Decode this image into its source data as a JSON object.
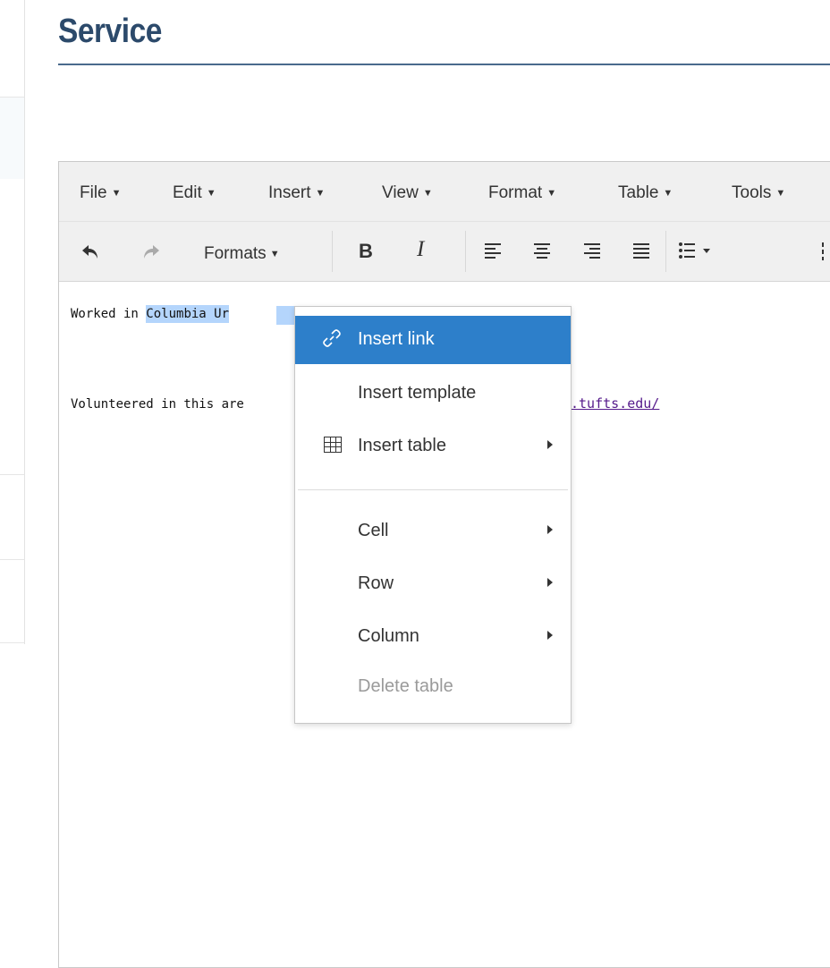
{
  "page": {
    "title": "Service"
  },
  "editor": {
    "menubar": [
      {
        "label": "File"
      },
      {
        "label": "Edit"
      },
      {
        "label": "Insert"
      },
      {
        "label": "View"
      },
      {
        "label": "Format"
      },
      {
        "label": "Table"
      },
      {
        "label": "Tools"
      }
    ],
    "toolbar": {
      "formats_label": "Formats",
      "bold_label": "B",
      "italic_label": "I",
      "undo_icon": "undo-icon",
      "redo_icon": "redo-icon"
    },
    "content": {
      "line1_prefix": "Worked in ",
      "line1_selected": "Columbia Ur",
      "line2_text": "Volunteered in this are",
      "line2_link_fragment": ".tufts.edu/"
    }
  },
  "context_menu": {
    "items": [
      {
        "label": "Insert link",
        "icon": "link-icon",
        "state": "highlighted"
      },
      {
        "label": "Insert template"
      },
      {
        "label": "Insert table",
        "icon": "table-icon",
        "submenu": true
      },
      {
        "label": "Cell",
        "submenu": true
      },
      {
        "label": "Row",
        "submenu": true
      },
      {
        "label": "Column",
        "submenu": true
      },
      {
        "label": "Delete table",
        "state": "disabled"
      }
    ]
  },
  "colors": {
    "title": "#2c4a6b",
    "menu_highlight": "#2d7fca",
    "selection": "#b4d5fc",
    "visited_link": "#551a8b"
  }
}
